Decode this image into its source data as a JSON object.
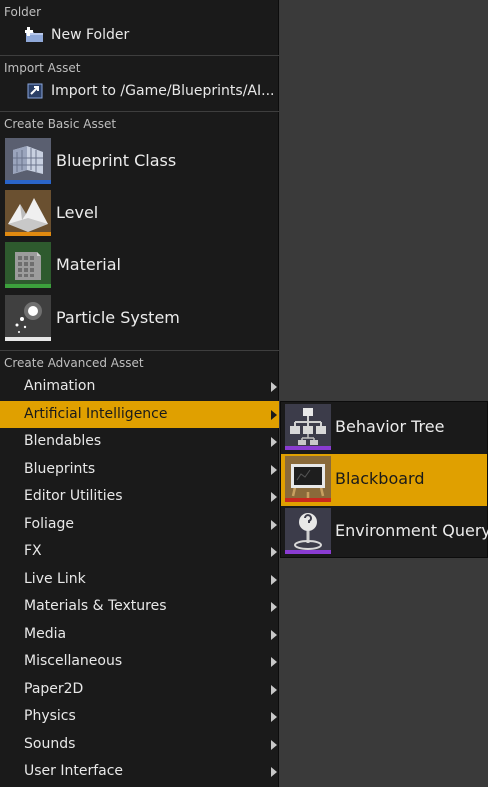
{
  "folder": {
    "header": "Folder",
    "new_folder": "New Folder",
    "icon": "new-folder-icon"
  },
  "import": {
    "header": "Import Asset",
    "label": "Import to /Game/Blueprints/AI...",
    "icon": "import-icon"
  },
  "basic": {
    "header": "Create Basic Asset",
    "items": [
      {
        "label": "Blueprint Class",
        "icon": "blueprint-class-icon",
        "color": "#2a64c8"
      },
      {
        "label": "Level",
        "icon": "level-icon",
        "color": "#e08a10"
      },
      {
        "label": "Material",
        "icon": "material-icon",
        "color": "#3ca03c"
      },
      {
        "label": "Particle System",
        "icon": "particle-system-icon",
        "color": "#e8e8e8"
      }
    ]
  },
  "advanced": {
    "header": "Create Advanced Asset",
    "items": [
      {
        "label": "Animation"
      },
      {
        "label": "Artificial Intelligence",
        "active": true
      },
      {
        "label": "Blendables"
      },
      {
        "label": "Blueprints"
      },
      {
        "label": "Editor Utilities"
      },
      {
        "label": "Foliage"
      },
      {
        "label": "FX"
      },
      {
        "label": "Live Link"
      },
      {
        "label": "Materials & Textures"
      },
      {
        "label": "Media"
      },
      {
        "label": "Miscellaneous"
      },
      {
        "label": "Paper2D"
      },
      {
        "label": "Physics"
      },
      {
        "label": "Sounds"
      },
      {
        "label": "User Interface"
      }
    ]
  },
  "ai_submenu": {
    "items": [
      {
        "label": "Behavior Tree",
        "icon": "behavior-tree-icon",
        "color": "#8a3cd2"
      },
      {
        "label": "Blackboard",
        "icon": "blackboard-icon",
        "color": "#c8281e",
        "active": true
      },
      {
        "label": "Environment Query",
        "icon": "environment-query-icon",
        "color": "#8a3cd2"
      }
    ]
  },
  "colors": {
    "menu_bg": "#1a1a1a",
    "highlight": "#e0a000",
    "page_bg": "#3a3a3a"
  }
}
